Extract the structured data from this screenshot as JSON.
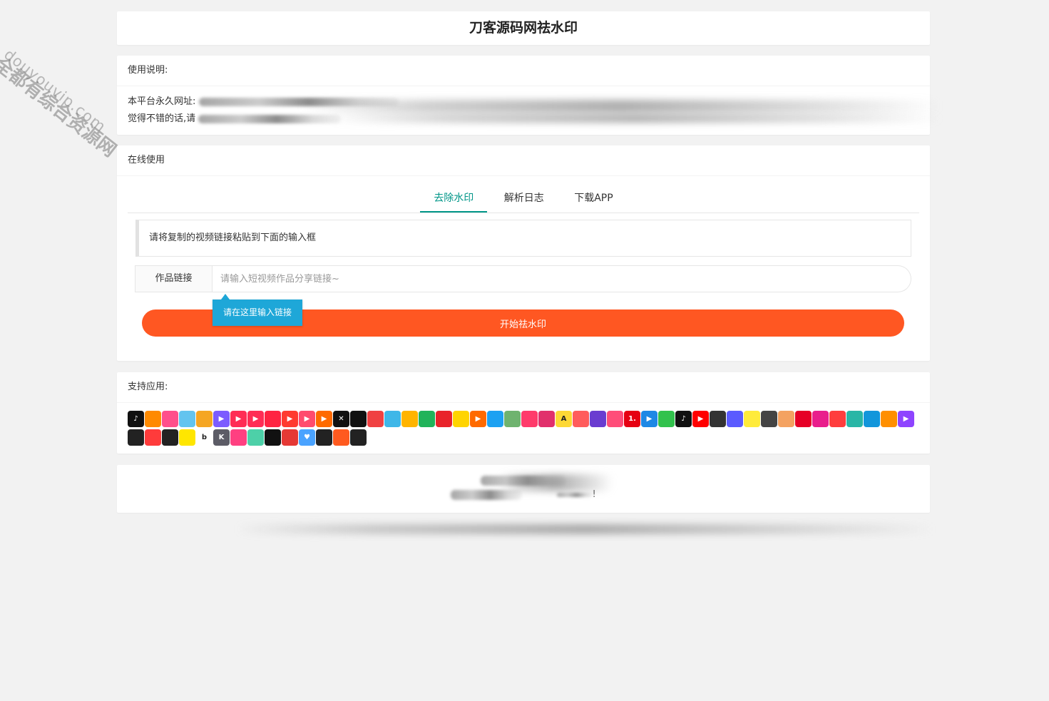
{
  "page": {
    "title": "刀客源码网祛水印"
  },
  "usage": {
    "header": "使用说明:",
    "line1_prefix": "本平台永久网址:",
    "line2_prefix": "觉得不错的话,请"
  },
  "online": {
    "header": "在线使用",
    "tabs": [
      {
        "label": "去除水印",
        "active": true
      },
      {
        "label": "解析日志",
        "active": false
      },
      {
        "label": "下载APP",
        "active": false
      }
    ],
    "notice": "请将复制的视频链接粘贴到下面的输入框",
    "input_label": "作品链接",
    "input_placeholder": "请输入短视频作品分享链接~",
    "input_value": "",
    "tooltip": "请在这里输入链接",
    "submit_label": "开始祛水印"
  },
  "apps": {
    "header": "支持应用:",
    "icons": [
      {
        "name": "tiktok-icon",
        "color": "#111111",
        "glyph": "♪"
      },
      {
        "name": "kuaishou-icon",
        "color": "#ff8a00",
        "glyph": ""
      },
      {
        "name": "pipixia-icon",
        "color": "#ff4f8b",
        "glyph": ""
      },
      {
        "name": "bilibili-icon",
        "color": "#63c4ef",
        "glyph": ""
      },
      {
        "name": "weibo-icon",
        "color": "#f5a623",
        "glyph": ""
      },
      {
        "name": "weishi-icon",
        "color": "#7c5cff",
        "glyph": "▶"
      },
      {
        "name": "video-app-icon",
        "color": "#ff2d55",
        "glyph": "▶"
      },
      {
        "name": "quanmin-icon",
        "color": "#ff2d55",
        "glyph": "▶"
      },
      {
        "name": "xiaohongshu-icon",
        "color": "#ff2442",
        "glyph": ""
      },
      {
        "name": "huoshan-icon",
        "color": "#ff3b30",
        "glyph": "▶"
      },
      {
        "name": "haokan-icon",
        "color": "#ff4b6e",
        "glyph": "▶"
      },
      {
        "name": "play-icon",
        "color": "#ff6a00",
        "glyph": "▶"
      },
      {
        "name": "capcut-icon",
        "color": "#111111",
        "glyph": "✕"
      },
      {
        "name": "xigua-icon",
        "color": "#111111",
        "glyph": ""
      },
      {
        "name": "toutiao-icon",
        "color": "#f04142",
        "glyph": ""
      },
      {
        "name": "lvzhou-icon",
        "color": "#3fb7e8",
        "glyph": ""
      },
      {
        "name": "kuai-icon",
        "color": "#ffb400",
        "glyph": ""
      },
      {
        "name": "qutoutiao-icon",
        "color": "#21b35a",
        "glyph": ""
      },
      {
        "name": "kuaibao-icon",
        "color": "#e9232a",
        "glyph": ""
      },
      {
        "name": "bird-icon",
        "color": "#ffd400",
        "glyph": ""
      },
      {
        "name": "orange-play-icon",
        "color": "#ff6a00",
        "glyph": "▶"
      },
      {
        "name": "twitter-icon",
        "color": "#1da1f2",
        "glyph": ""
      },
      {
        "name": "plant-icon",
        "color": "#6fb36f",
        "glyph": ""
      },
      {
        "name": "weibo-video-icon",
        "color": "#ff3b6b",
        "glyph": ""
      },
      {
        "name": "instagram-icon",
        "color": "#e1306c",
        "glyph": ""
      },
      {
        "name": "acfun-icon",
        "color": "#fdd835",
        "glyph": "A"
      },
      {
        "name": "avatar-app-icon",
        "color": "#ff5c5c",
        "glyph": ""
      },
      {
        "name": "shua-icon",
        "color": "#6a3cd0",
        "glyph": ""
      },
      {
        "name": "live-icon",
        "color": "#ff4d79",
        "glyph": ""
      },
      {
        "name": "yidian-icon",
        "color": "#e60012",
        "glyph": "1."
      },
      {
        "name": "youku-icon",
        "color": "#1e88e5",
        "glyph": "▶"
      },
      {
        "name": "iqiyi-icon",
        "color": "#32c24d",
        "glyph": ""
      },
      {
        "name": "music-note-icon",
        "color": "#111111",
        "glyph": "♪"
      },
      {
        "name": "youtube-icon",
        "color": "#ff0000",
        "glyph": "▶"
      },
      {
        "name": "panda-icon",
        "color": "#333333",
        "glyph": ""
      },
      {
        "name": "chat-icon",
        "color": "#5b5bff",
        "glyph": ""
      },
      {
        "name": "meipai-icon",
        "color": "#ffeb3b",
        "glyph": ""
      },
      {
        "name": "camera-icon",
        "color": "#444444",
        "glyph": ""
      },
      {
        "name": "face-icon",
        "color": "#f4a261",
        "glyph": ""
      },
      {
        "name": "netease-icon",
        "color": "#e60026",
        "glyph": ""
      },
      {
        "name": "video-pink-icon",
        "color": "#e91e8c",
        "glyph": ""
      },
      {
        "name": "cartoon-icon",
        "color": "#ff3d3d",
        "glyph": ""
      },
      {
        "name": "bowl-icon",
        "color": "#29b6a6",
        "glyph": ""
      },
      {
        "name": "qq-icon",
        "color": "#1296db",
        "glyph": ""
      },
      {
        "name": "uc-icon",
        "color": "#ff8f00",
        "glyph": ""
      },
      {
        "name": "purple-play-icon",
        "color": "#8e44ff",
        "glyph": "▶"
      },
      {
        "name": "stripes-icon",
        "color": "#222222",
        "glyph": ""
      },
      {
        "name": "new-icon",
        "color": "#ff3b3b",
        "glyph": ""
      },
      {
        "name": "lib-icon",
        "color": "#222222",
        "glyph": ""
      },
      {
        "name": "circle-yellow-icon",
        "color": "#ffe600",
        "glyph": ""
      },
      {
        "name": "b-icon",
        "color": "#ffffff",
        "glyph": "b"
      },
      {
        "name": "k-icon",
        "color": "#5c5c66",
        "glyph": "K"
      },
      {
        "name": "pink-app-icon",
        "color": "#ff4081",
        "glyph": ""
      },
      {
        "name": "gradient-app-icon",
        "color": "#4dd0a8",
        "glyph": ""
      },
      {
        "name": "mouth-icon",
        "color": "#111111",
        "glyph": ""
      },
      {
        "name": "monkey-icon",
        "color": "#e53935",
        "glyph": ""
      },
      {
        "name": "heart-icon",
        "color": "#4aa3ff",
        "glyph": "♥"
      },
      {
        "name": "bishan-icon",
        "color": "#222222",
        "glyph": ""
      },
      {
        "name": "food-icon",
        "color": "#ff5a1f",
        "glyph": ""
      },
      {
        "name": "ring-icon",
        "color": "#222222",
        "glyph": ""
      }
    ]
  },
  "footer": {
    "line2_suffix": "!"
  }
}
